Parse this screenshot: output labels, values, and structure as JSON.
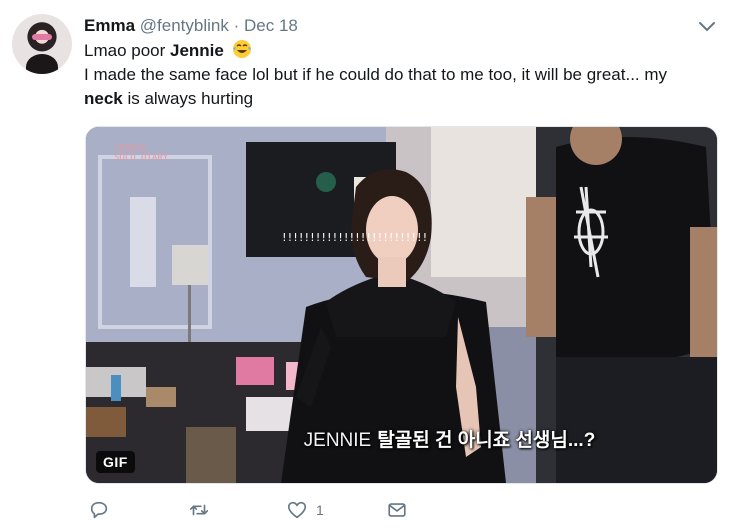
{
  "tweet": {
    "author_name": "Emma",
    "author_handle": "@fentyblink",
    "separator": "·",
    "date": "Dec 18",
    "line1_prefix": "Lmao poor ",
    "line1_bold": "Jennie",
    "line2": "I made the same face lol but if he could do that to me too, it will be great... my",
    "line3_bold": "neck",
    "line3_rest": " is always hurting"
  },
  "media": {
    "badge": "GIF",
    "watermark_line1": "JENNIE",
    "watermark_line2": "SOLO DIARY",
    "screen_text": "!!!!!!!!!!!!!!!!!!!!!!!!!!",
    "subtitle_speaker": "JENNIE",
    "subtitle_text": "탈골된 건 아니죠 선생님...?"
  },
  "actions": {
    "reply_count": "",
    "retweet_count": "",
    "like_count": "1"
  },
  "icons": {
    "reply": "reply-icon",
    "retweet": "retweet-icon",
    "like": "heart-icon",
    "dm": "envelope-icon",
    "menu": "chevron-down-icon",
    "emoji": "tears-of-joy-emoji-icon"
  },
  "colors": {
    "secondary_text": "#657786",
    "primary_text": "#14171a"
  }
}
